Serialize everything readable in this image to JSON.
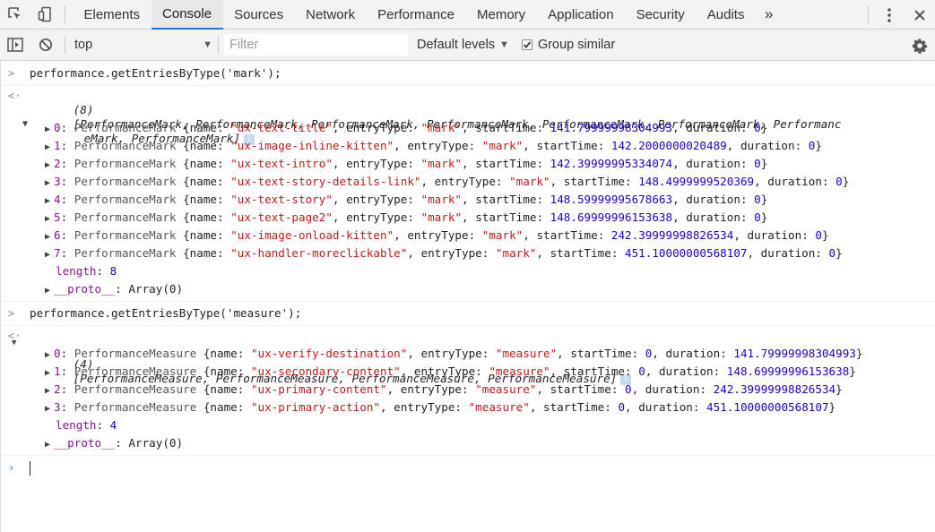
{
  "tabs": [
    {
      "label": "Elements",
      "active": false
    },
    {
      "label": "Console",
      "active": true
    },
    {
      "label": "Sources",
      "active": false
    },
    {
      "label": "Network",
      "active": false
    },
    {
      "label": "Performance",
      "active": false
    },
    {
      "label": "Memory",
      "active": false
    },
    {
      "label": "Application",
      "active": false
    },
    {
      "label": "Security",
      "active": false
    },
    {
      "label": "Audits",
      "active": false
    }
  ],
  "tabbar": {
    "more_label": "»"
  },
  "toolbar": {
    "context": "top",
    "filter_placeholder": "Filter",
    "levels_label": "Default levels",
    "group_label": "Group similar",
    "group_checked": true
  },
  "console": {
    "cmd1": "performance.getEntriesByType('mark');",
    "result1_count": "(8)",
    "result1_summary_line1": "[PerformanceMark, PerformanceMark, PerformanceMark, PerformanceMark, PerformanceMark, PerformanceMark, Performanc",
    "result1_summary_line2": "eMark, PerformanceMark]",
    "marks": [
      {
        "index": "0",
        "name": "\"ux-text-title\"",
        "type": "\"mark\"",
        "start": "141.79999998304993",
        "duration": "0"
      },
      {
        "index": "1",
        "name": "\"ux-image-inline-kitten\"",
        "type": "\"mark\"",
        "start": "142.2000000020489",
        "duration": "0"
      },
      {
        "index": "2",
        "name": "\"ux-text-intro\"",
        "type": "\"mark\"",
        "start": "142.39999995334074",
        "duration": "0"
      },
      {
        "index": "3",
        "name": "\"ux-text-story-details-link\"",
        "type": "\"mark\"",
        "start": "148.4999999520369",
        "duration": "0"
      },
      {
        "index": "4",
        "name": "\"ux-text-story\"",
        "type": "\"mark\"",
        "start": "148.59999995678663",
        "duration": "0"
      },
      {
        "index": "5",
        "name": "\"ux-text-page2\"",
        "type": "\"mark\"",
        "start": "148.69999996153638",
        "duration": "0"
      },
      {
        "index": "6",
        "name": "\"ux-image-onload-kitten\"",
        "type": "\"mark\"",
        "start": "242.39999998826534",
        "duration": "0"
      },
      {
        "index": "7",
        "name": "\"ux-handler-moreclickable\"",
        "type": "\"mark\"",
        "start": "451.10000000568107",
        "duration": "0"
      }
    ],
    "marks_class": "PerformanceMark",
    "length1": "8",
    "proto": "__proto__",
    "proto_value": "Array(0)",
    "cmd2": "performance.getEntriesByType('measure');",
    "result2_count": "(4)",
    "result2_summary": "[PerformanceMeasure, PerformanceMeasure, PerformanceMeasure, PerformanceMeasure]",
    "measures": [
      {
        "index": "0",
        "name": "\"ux-verify-destination\"",
        "type": "\"measure\"",
        "start": "0",
        "duration": "141.79999998304993"
      },
      {
        "index": "1",
        "name": "\"ux-secondary-content\"",
        "type": "\"measure\"",
        "start": "0",
        "duration": "148.69999996153638"
      },
      {
        "index": "2",
        "name": "\"ux-primary-content\"",
        "type": "\"measure\"",
        "start": "0",
        "duration": "242.39999998826534"
      },
      {
        "index": "3",
        "name": "\"ux-primary-action\"",
        "type": "\"measure\"",
        "start": "0",
        "duration": "451.10000000568107"
      }
    ],
    "measures_class": "PerformanceMeasure",
    "length2": "4"
  },
  "colors": {
    "accent": "#1a73e8",
    "string": "#c41a16",
    "number": "#1c00cf",
    "key": "#881391"
  },
  "icons": [
    "inspect-element-icon",
    "device-toolbar-icon",
    "more-vert-icon",
    "close-icon",
    "sidebar-toggle-icon",
    "clear-console-icon",
    "dropdown-caret-icon",
    "settings-gear-icon",
    "info-icon",
    "expand-triangle-icon",
    "input-prompt-icon",
    "result-arrow-icon"
  ]
}
